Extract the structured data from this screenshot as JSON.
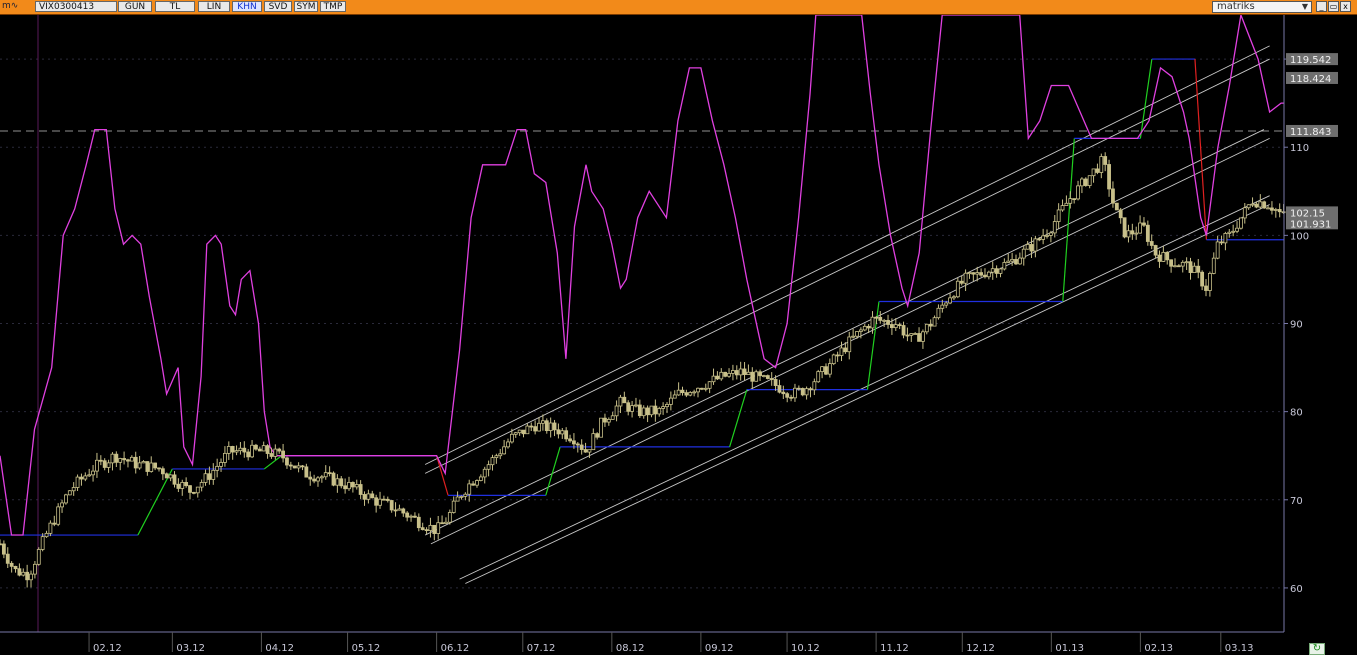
{
  "toolbar": {
    "symbol": "VIX0300413",
    "buttons": [
      "GUN",
      "TL",
      "LIN",
      "KHN",
      "SVD",
      "SYM",
      "TMP"
    ],
    "active": "KHN",
    "brand": "matriks",
    "brand_arrow": "▼",
    "window_controls": [
      "_",
      "▭",
      "x"
    ],
    "window_icon": "m∿"
  },
  "colors": {
    "title_bar": "#f28a1a",
    "price": "#c8c08a",
    "oscillator": "#e040e0",
    "stop_line": "#2030e0",
    "up": "#20d020",
    "down": "#e02020",
    "channel": "#c8c8c8",
    "axis": "#7878a8",
    "dashed_level": "#909090"
  },
  "chart_data": {
    "type": "candlestick",
    "yaxis": {
      "ticks": [
        60,
        70,
        80,
        90,
        100,
        110,
        120
      ],
      "range": [
        55,
        125
      ]
    },
    "xaxis": {
      "labels": [
        "02.12",
        "03.12",
        "04.12",
        "05.12",
        "06.12",
        "07.12",
        "08.12",
        "09.12",
        "10.12",
        "11.12",
        "12.12",
        "01.13",
        "02.13",
        "03.13"
      ],
      "label_days": [
        31,
        60,
        91,
        121,
        152,
        182,
        213,
        244,
        274,
        305,
        335,
        366,
        397,
        425
      ],
      "range_days": [
        0,
        447
      ]
    },
    "price_labels": [
      "119.542",
      "118.424",
      "111.843",
      "102.15",
      "101.931"
    ],
    "price_label_values": [
      119.542,
      118.424,
      111.843,
      102.15,
      101.931
    ],
    "dashed_level": 111.843,
    "price_anchors": [
      [
        0,
        65
      ],
      [
        5,
        62
      ],
      [
        10,
        61.5
      ],
      [
        16,
        66
      ],
      [
        24,
        71
      ],
      [
        32,
        73.5
      ],
      [
        40,
        75
      ],
      [
        48,
        74
      ],
      [
        56,
        73.5
      ],
      [
        62,
        72
      ],
      [
        66,
        71
      ],
      [
        72,
        72.5
      ],
      [
        80,
        75.5
      ],
      [
        92,
        75.5
      ],
      [
        98,
        75
      ],
      [
        106,
        73
      ],
      [
        114,
        72.5
      ],
      [
        122,
        71.5
      ],
      [
        130,
        70
      ],
      [
        138,
        69
      ],
      [
        146,
        67.5
      ],
      [
        152,
        66.5
      ],
      [
        156,
        68
      ],
      [
        160,
        70.5
      ],
      [
        164,
        72
      ],
      [
        170,
        74
      ],
      [
        178,
        77
      ],
      [
        186,
        78.5
      ],
      [
        194,
        78
      ],
      [
        200,
        77
      ],
      [
        204,
        75.5
      ],
      [
        210,
        79
      ],
      [
        216,
        81
      ],
      [
        222,
        80
      ],
      [
        230,
        80
      ],
      [
        236,
        82
      ],
      [
        244,
        83
      ],
      [
        252,
        84
      ],
      [
        258,
        84.5
      ],
      [
        262,
        84
      ],
      [
        270,
        83
      ],
      [
        276,
        82
      ],
      [
        280,
        82.5
      ],
      [
        288,
        85
      ],
      [
        296,
        88
      ],
      [
        304,
        90.5
      ],
      [
        312,
        90
      ],
      [
        318,
        88
      ],
      [
        324,
        90
      ],
      [
        330,
        93
      ],
      [
        336,
        95
      ],
      [
        344,
        96
      ],
      [
        352,
        97
      ],
      [
        360,
        99
      ],
      [
        366,
        101
      ],
      [
        372,
        104
      ],
      [
        380,
        107
      ],
      [
        384,
        108.5
      ],
      [
        388,
        103
      ],
      [
        392,
        100
      ],
      [
        398,
        101
      ],
      [
        402,
        98
      ],
      [
        408,
        97
      ],
      [
        414,
        96.5
      ],
      [
        418,
        95
      ],
      [
        420,
        94
      ],
      [
        424,
        99
      ],
      [
        428,
        100
      ],
      [
        432,
        102
      ],
      [
        436,
        104
      ],
      [
        442,
        103.5
      ],
      [
        447,
        102.15
      ]
    ],
    "oscillator_anchors": [
      [
        0,
        75
      ],
      [
        4,
        66
      ],
      [
        8,
        66
      ],
      [
        12,
        78
      ],
      [
        18,
        85
      ],
      [
        22,
        100
      ],
      [
        26,
        103
      ],
      [
        30,
        108
      ],
      [
        33,
        112
      ],
      [
        37,
        112
      ],
      [
        40,
        103
      ],
      [
        43,
        99
      ],
      [
        46,
        100
      ],
      [
        49,
        99
      ],
      [
        52,
        93
      ],
      [
        56,
        86
      ],
      [
        58,
        82
      ],
      [
        62,
        85
      ],
      [
        64,
        76
      ],
      [
        67,
        74
      ],
      [
        70,
        84
      ],
      [
        72,
        99
      ],
      [
        75,
        100
      ],
      [
        77,
        99
      ],
      [
        80,
        92
      ],
      [
        82,
        91
      ],
      [
        84,
        95
      ],
      [
        87,
        96
      ],
      [
        90,
        90
      ],
      [
        92,
        80
      ],
      [
        94,
        76
      ],
      [
        96,
        75
      ],
      [
        152,
        75
      ],
      [
        155,
        73
      ],
      [
        160,
        87
      ],
      [
        164,
        102
      ],
      [
        168,
        108
      ],
      [
        172,
        108
      ],
      [
        176,
        108
      ],
      [
        180,
        112
      ],
      [
        183,
        112
      ],
      [
        186,
        107
      ],
      [
        190,
        106
      ],
      [
        194,
        98
      ],
      [
        197,
        86
      ],
      [
        200,
        101
      ],
      [
        204,
        108
      ],
      [
        206,
        105
      ],
      [
        210,
        103
      ],
      [
        213,
        99
      ],
      [
        216,
        94
      ],
      [
        218,
        95
      ],
      [
        222,
        102
      ],
      [
        226,
        105
      ],
      [
        232,
        102
      ],
      [
        236,
        113
      ],
      [
        240,
        119
      ],
      [
        244,
        119
      ],
      [
        248,
        113
      ],
      [
        252,
        108
      ],
      [
        256,
        102
      ],
      [
        260,
        95
      ],
      [
        264,
        89
      ],
      [
        266,
        86
      ],
      [
        270,
        85
      ],
      [
        274,
        90
      ],
      [
        278,
        102
      ],
      [
        282,
        116
      ],
      [
        284,
        125
      ],
      [
        300,
        125
      ],
      [
        303,
        116
      ],
      [
        306,
        108
      ],
      [
        310,
        100
      ],
      [
        314,
        94
      ],
      [
        316,
        92
      ],
      [
        320,
        98
      ],
      [
        324,
        112
      ],
      [
        328,
        125
      ],
      [
        352,
        125
      ],
      [
        355,
        125
      ],
      [
        358,
        111
      ],
      [
        362,
        113
      ],
      [
        366,
        117
      ],
      [
        372,
        117
      ],
      [
        376,
        114
      ],
      [
        380,
        111
      ],
      [
        384,
        111
      ],
      [
        392,
        111
      ],
      [
        396,
        111
      ],
      [
        400,
        113
      ],
      [
        404,
        119
      ],
      [
        408,
        118
      ],
      [
        412,
        114
      ],
      [
        414,
        111
      ],
      [
        418,
        102
      ],
      [
        420,
        100
      ],
      [
        424,
        110
      ],
      [
        428,
        117
      ],
      [
        432,
        125
      ],
      [
        438,
        120
      ],
      [
        442,
        114
      ],
      [
        446,
        115
      ],
      [
        447,
        115
      ]
    ],
    "stop_levels": [
      [
        0,
        66
      ],
      [
        48,
        66
      ],
      [
        60,
        73.5
      ],
      [
        92,
        73.5
      ],
      [
        98,
        75
      ],
      [
        152,
        75
      ],
      [
        156,
        70.5
      ],
      [
        190,
        70.5
      ],
      [
        195,
        76
      ],
      [
        254,
        76
      ],
      [
        260,
        82.5
      ],
      [
        302,
        82.5
      ],
      [
        306,
        92.5
      ],
      [
        370,
        92.5
      ],
      [
        374,
        111
      ],
      [
        397,
        111
      ],
      [
        401,
        120
      ],
      [
        416,
        120
      ],
      [
        420,
        99.5
      ],
      [
        447,
        99.5
      ]
    ],
    "channels": [
      [
        [
          148,
          74
        ],
        [
          442,
          121.5
        ]
      ],
      [
        [
          148,
          73
        ],
        [
          442,
          120
        ]
      ],
      [
        [
          148,
          66
        ],
        [
          440,
          112
        ]
      ],
      [
        [
          150,
          65
        ],
        [
          442,
          111
        ]
      ],
      [
        [
          160,
          61
        ],
        [
          442,
          104.5
        ]
      ],
      [
        [
          162,
          60.5
        ],
        [
          442,
          103.5
        ]
      ]
    ]
  }
}
